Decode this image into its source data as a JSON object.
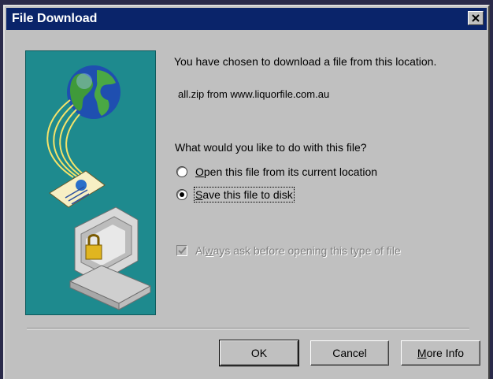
{
  "window": {
    "title": "File Download"
  },
  "message": {
    "heading": "You have chosen to download a file from this location.",
    "file_line": "all.zip from www.liquorfile.com.au",
    "question": "What would you like to do with this file?"
  },
  "options": [
    {
      "label_prefix": "",
      "accel": "O",
      "label_rest": "pen this file from its current location",
      "selected": false
    },
    {
      "label_prefix": "",
      "accel": "S",
      "label_rest": "ave this file to disk",
      "selected": true
    }
  ],
  "checkbox": {
    "label_prefix": "Al",
    "accel": "w",
    "label_rest": "ays ask before opening this type of file",
    "checked": true,
    "disabled": true
  },
  "buttons": {
    "ok": "OK",
    "cancel": "Cancel",
    "more_info_accel": "M",
    "more_info_rest": "ore Info"
  },
  "colors": {
    "titlebar": "#0a246a",
    "dialog_bg": "#c0c0c0",
    "illustration_bg": "#1e8a8e"
  }
}
